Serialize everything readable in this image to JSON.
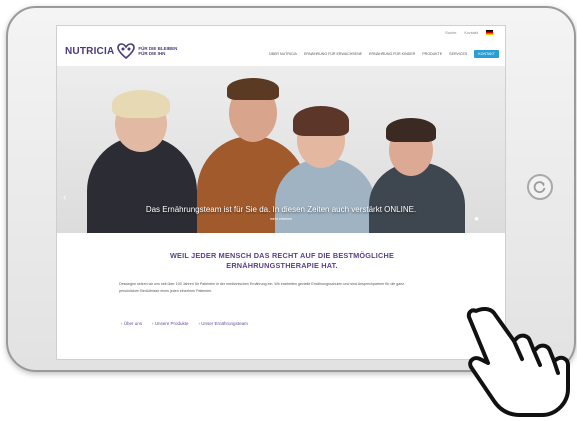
{
  "brand": {
    "logo_text": "NUTRICIA",
    "tagline_line1": "FÜR DIE BLEIBEN",
    "tagline_line2": "FÜR DIE IHN"
  },
  "utility": {
    "search": "Suche",
    "contact": "Kontakt"
  },
  "nav": {
    "items": [
      "ÜBER NUTRICIA",
      "ERNÄHRUNG FÜR ERWACHSENE",
      "ERNÄHRUNG FÜR KINDER",
      "PRODUKTE",
      "SERVICES"
    ],
    "cta": "KONTAKT"
  },
  "hero": {
    "caption": "Das Ernährungsteam ist für Sie da. In diesen Zeiten auch verstärkt ONLINE.",
    "sub": "mehr erfahren"
  },
  "content": {
    "headline_line1": "WEIL JEDER MENSCH DAS RECHT AUF DIE BESTMÖGLICHE",
    "headline_line2": "ERNÄHRUNGSTHERAPIE HAT.",
    "body": "Deswegen setzen wir uns seit über 100 Jahren für Patienten in der medizinischen Ernährung ein. Wir erarbeiten gezielte Ernährungsschulen und sind Ansprechpartner für die ganz persönlichen Bedürfnisse eines jeden einzelnen Patienten.",
    "links": [
      "› Über uns",
      "› Unsere Produkte",
      "› Unser Ernährungsteam"
    ]
  },
  "colors": {
    "brand_purple": "#5b3f88",
    "nav_cta": "#2a9fd6"
  },
  "icons": {
    "home_button": "refresh-icon",
    "cursor": "hand-pointer-icon"
  }
}
